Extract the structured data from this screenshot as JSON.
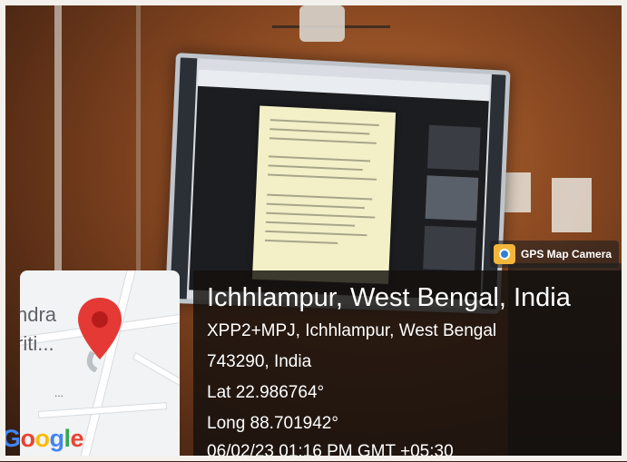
{
  "overlay": {
    "map_labels": [
      "ndra",
      "riti..."
    ],
    "map_more": "...",
    "brand": "Google",
    "camera_app": "GPS Map Camera",
    "place_title": "Ichhlampur, West Bengal, India",
    "address_line1": "XPP2+MPJ, Ichhlampur, West Bengal",
    "address_line2": "743290, India",
    "latitude": "Lat 22.986764°",
    "longitude": "Long 88.701942°",
    "timestamp": "06/02/23 01:16 PM GMT +05:30"
  },
  "colors": {
    "pin_red": "#e53935",
    "google_blue": "#4285f4",
    "google_red": "#ea4335",
    "google_yellow": "#fbbc05",
    "google_green": "#34a853"
  }
}
